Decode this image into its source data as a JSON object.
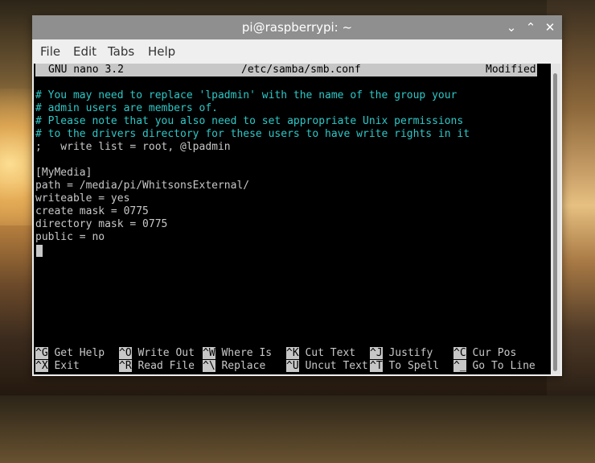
{
  "window": {
    "title": "pi@raspberrypi: ~"
  },
  "menu": [
    "File",
    "Edit",
    "Tabs",
    "Help"
  ],
  "nano": {
    "version": "GNU nano 3.2",
    "file": "/etc/samba/smb.conf",
    "status": "Modified"
  },
  "lines": [
    "# You may need to replace 'lpadmin' with the name of the group your",
    "# admin users are members of.",
    "# Please note that you also need to set appropriate Unix permissions",
    "# to the drivers directory for these users to have write rights in it",
    ";   write list = root, @lpadmin",
    "",
    "[MyMedia]",
    "path = /media/pi/WhitsonsExternal/",
    "writeable = yes",
    "create mask = 0775",
    "directory mask = 0775",
    "public = no"
  ],
  "shortcuts": [
    [
      {
        "key": "^G",
        "label": "Get Help"
      },
      {
        "key": "^O",
        "label": "Write Out"
      },
      {
        "key": "^W",
        "label": "Where Is"
      },
      {
        "key": "^K",
        "label": "Cut Text"
      },
      {
        "key": "^J",
        "label": "Justify"
      },
      {
        "key": "^C",
        "label": "Cur Pos"
      }
    ],
    [
      {
        "key": "^X",
        "label": "Exit"
      },
      {
        "key": "^R",
        "label": "Read File"
      },
      {
        "key": "^\\",
        "label": "Replace"
      },
      {
        "key": "^U",
        "label": "Uncut Text"
      },
      {
        "key": "^T",
        "label": "To Spell"
      },
      {
        "key": "^_",
        "label": "Go To Line"
      }
    ]
  ]
}
